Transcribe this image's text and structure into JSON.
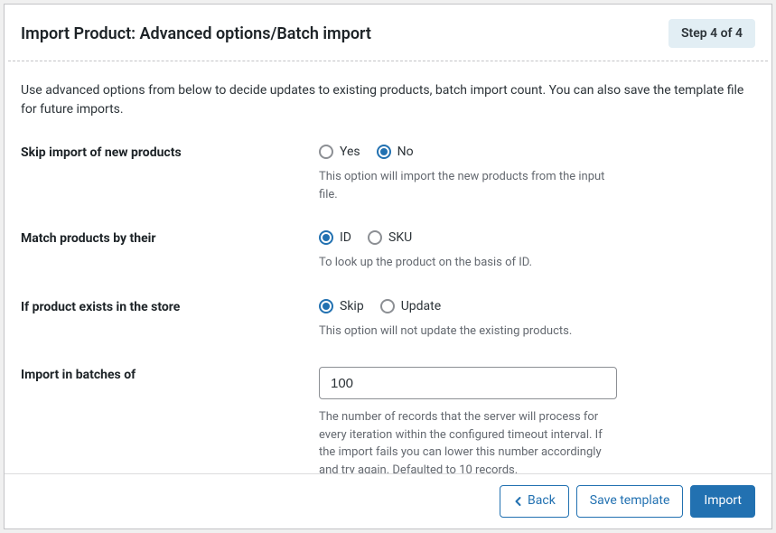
{
  "header": {
    "title": "Import Product: Advanced options/Batch import",
    "step_label": "Step 4 of 4"
  },
  "intro": "Use advanced options from below to decide updates to existing products, batch import count. You can also save the template file for future imports.",
  "fields": {
    "skip_new": {
      "label": "Skip import of new products",
      "opt_yes": "Yes",
      "opt_no": "No",
      "help": "This option will import the new products from the input file."
    },
    "match_by": {
      "label": "Match products by their",
      "opt_id": "ID",
      "opt_sku": "SKU",
      "help": "To look up the product on the basis of ID."
    },
    "if_exists": {
      "label": "If product exists in the store",
      "opt_skip": "Skip",
      "opt_update": "Update",
      "help": "This option will not update the existing products."
    },
    "batch": {
      "label": "Import in batches of",
      "value": "100",
      "help": "The number of records that the server will process for every iteration within the configured timeout interval. If the import fails you can lower this number accordingly and try again. Defaulted to 10 records."
    }
  },
  "footer": {
    "back": "Back",
    "save_template": "Save template",
    "import": "Import"
  }
}
